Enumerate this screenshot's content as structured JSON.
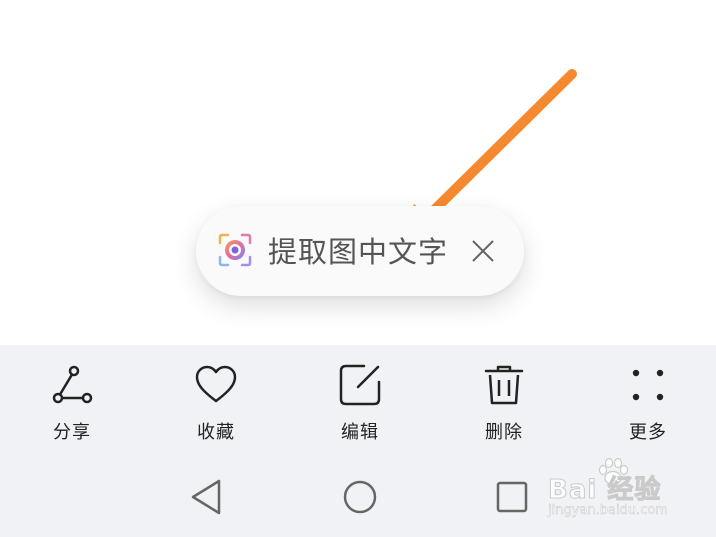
{
  "ocr_chip": {
    "label": "提取图中文字",
    "icon": "camera-lens-icon",
    "close_icon": "close-icon"
  },
  "annotation": {
    "icon": "arrow-icon",
    "color": "#f5892f"
  },
  "actions": [
    {
      "id": "share",
      "label": "分享",
      "icon": "share-icon"
    },
    {
      "id": "favorite",
      "label": "收藏",
      "icon": "heart-icon"
    },
    {
      "id": "edit",
      "label": "编辑",
      "icon": "edit-icon"
    },
    {
      "id": "delete",
      "label": "删除",
      "icon": "trash-icon"
    },
    {
      "id": "more",
      "label": "更多",
      "icon": "more-dots-icon"
    }
  ],
  "nav": {
    "back_icon": "back-triangle-icon",
    "home_icon": "home-circle-icon",
    "recent_icon": "recent-square-icon"
  },
  "watermark": {
    "logo": "Bai 经验",
    "url": "jingyan.baidu.com"
  },
  "colors": {
    "action_bar_bg": "#f1f2f5",
    "icon_stroke": "#222222",
    "chip_text": "#555555",
    "arrow": "#f5892f"
  }
}
